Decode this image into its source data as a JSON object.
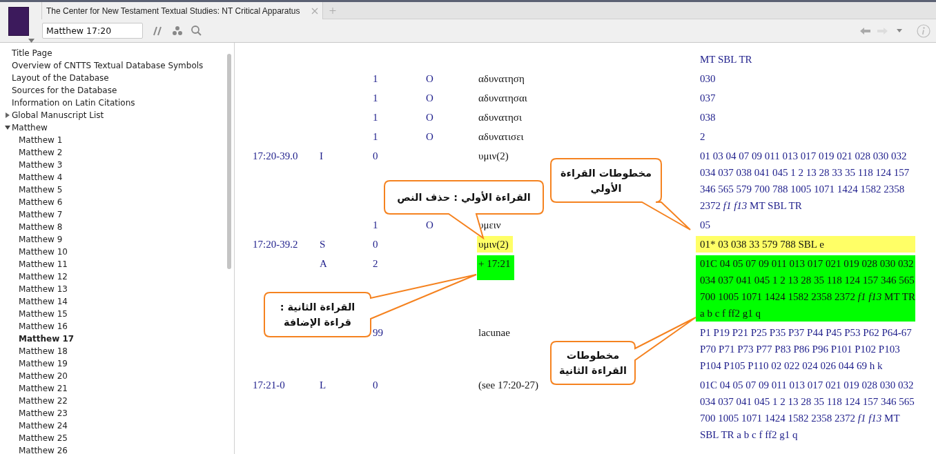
{
  "tab": {
    "title": "The Center for New Testament Textual Studies: NT Critical Apparatus"
  },
  "toolbar": {
    "reference": "Matthew 17:20"
  },
  "sidebar": {
    "items": [
      {
        "label": "Title Page",
        "selected": false
      },
      {
        "label": "Overview of CNTTS Textual Database Symbols",
        "selected": false
      },
      {
        "label": "Layout of the Database",
        "selected": false
      },
      {
        "label": "Sources for the Database",
        "selected": false
      },
      {
        "label": "Information on Latin Citations",
        "selected": false
      },
      {
        "label": "Global Manuscript List",
        "selected": false,
        "expanded": false
      },
      {
        "label": "Matthew",
        "selected": false,
        "expanded": true,
        "children": [
          {
            "label": "Matthew 1",
            "selected": false
          },
          {
            "label": "Matthew 2",
            "selected": false
          },
          {
            "label": "Matthew 3",
            "selected": false
          },
          {
            "label": "Matthew 4",
            "selected": false
          },
          {
            "label": "Matthew 5",
            "selected": false
          },
          {
            "label": "Matthew 6",
            "selected": false
          },
          {
            "label": "Matthew 7",
            "selected": false
          },
          {
            "label": "Matthew 8",
            "selected": false
          },
          {
            "label": "Matthew 9",
            "selected": false
          },
          {
            "label": "Matthew 10",
            "selected": false
          },
          {
            "label": "Matthew 11",
            "selected": false
          },
          {
            "label": "Matthew 12",
            "selected": false
          },
          {
            "label": "Matthew 13",
            "selected": false
          },
          {
            "label": "Matthew 14",
            "selected": false
          },
          {
            "label": "Matthew 15",
            "selected": false
          },
          {
            "label": "Matthew 16",
            "selected": false
          },
          {
            "label": "Matthew 17",
            "selected": true
          },
          {
            "label": "Matthew 18",
            "selected": false
          },
          {
            "label": "Matthew 19",
            "selected": false
          },
          {
            "label": "Matthew 20",
            "selected": false
          },
          {
            "label": "Matthew 21",
            "selected": false
          },
          {
            "label": "Matthew 22",
            "selected": false
          },
          {
            "label": "Matthew 23",
            "selected": false
          },
          {
            "label": "Matthew 24",
            "selected": false
          },
          {
            "label": "Matthew 25",
            "selected": false
          },
          {
            "label": "Matthew 26",
            "selected": false
          }
        ]
      }
    ]
  },
  "apparatus": {
    "rows": [
      {
        "witnesses": {
          "text": "MT SBL TR"
        }
      },
      {
        "count": "1",
        "code": "O",
        "reading": {
          "text": "αδυνατηση"
        },
        "witnesses": {
          "text": "030"
        }
      },
      {
        "count": "1",
        "code": "O",
        "reading": {
          "text": "αδυνατησαι"
        },
        "witnesses": {
          "text": "037"
        }
      },
      {
        "count": "1",
        "code": "O",
        "reading": {
          "text": "αδυνατησι"
        },
        "witnesses": {
          "text": "038"
        }
      },
      {
        "count": "1",
        "code": "O",
        "reading": {
          "text": "αδυνατισει"
        },
        "witnesses": {
          "text": "2"
        }
      },
      {
        "ref": "17:20-39.0",
        "type": "I",
        "count": "0",
        "reading": {
          "text": "υμιν(2)"
        },
        "witnesses": {
          "text": "01 03 04 07 09 011 013 017 019 021 028 030 032 034 037 038 041 045 1 2 13 28 33 35 118 124 157 346 565 579 700 788 1005 1071 1424 1582 2358 2372 *f1* *f13* MT SBL TR"
        }
      },
      {
        "count": "1",
        "code": "O",
        "reading": {
          "text": "υμειν"
        },
        "witnesses": {
          "text": "05"
        }
      },
      {
        "ref": "17:20-39.2",
        "type": "S",
        "count": "0",
        "reading": {
          "text": "υμιν(2)",
          "color": "#ffff66"
        },
        "witnesses": {
          "text": "01* 03 038 33 579 788 SBL e",
          "color": "#ffff66"
        }
      },
      {
        "type": "A",
        "count": "2",
        "reading": {
          "text": "+ 17:21",
          "color": "#00ff00"
        },
        "witnesses": {
          "text": "01C 04 05 07 09 011 013 017 021 019 028 030 032 034 037 041 045 1 2 13 28 35 118 124 157 346 565 700 1005 1071 1424 1582 2358 2372 *f1* *f13* MT TR a b c f ff2 g1 q",
          "color": "#00ff00"
        }
      },
      {
        "count": "99",
        "reading": {
          "text": "lacunae"
        },
        "witnesses": {
          "text": "P1 P19 P21 P25 P35 P37 P44 P45 P53 P62 P64-67 P70 P71 P73 P77 P83 P86 P96 P101 P102 P103 P104 P105 P110 02 022 024 026 044 69 h k"
        }
      },
      {
        "ref": "17:21-0",
        "type": "L",
        "count": "0",
        "reading": {
          "text": "(see 17:20-27)"
        },
        "witnesses": {
          "text": "01C 04 05 07 09 011 013 017 021 019 028 030 032 034 037 041 045 1 2 13 28 35 118 124 157 346 565 700 1005 1071 1424 1582 2358 2372 *f1* *f13* MT SBL TR a b c f ff2 g1 q"
        }
      }
    ]
  },
  "callouts": [
    {
      "text": "القراءة الأولي : حذف النص"
    },
    {
      "text": "مخطوطات القراءة الأولي"
    },
    {
      "text": "القراءة الثانية : قراءة الإضافة"
    },
    {
      "text": "مخطوطات القراءة الثانية"
    }
  ]
}
